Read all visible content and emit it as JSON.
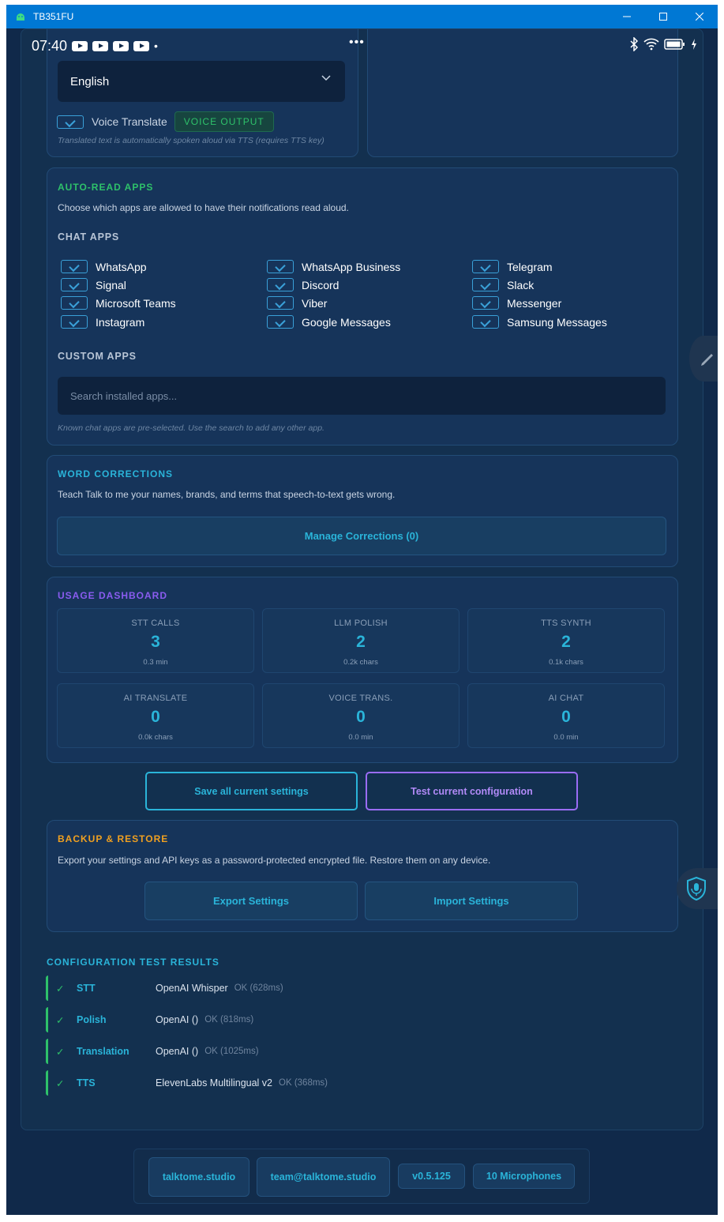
{
  "window": {
    "title": "TB351FU",
    "controls": [
      "minimize",
      "maximize",
      "close"
    ]
  },
  "statusbar": {
    "time": "07:40",
    "overflow": "•••",
    "dot": "•"
  },
  "translate": {
    "language": "English",
    "voice_translate_label": "Voice Translate",
    "voice_output_badge": "VOICE OUTPUT",
    "note": "Translated text is automatically spoken aloud via TTS (requires TTS key)"
  },
  "auto_read": {
    "title": "AUTO-READ APPS",
    "description": "Choose which apps are allowed to have their notifications read aloud.",
    "chat_apps_label": "CHAT APPS",
    "apps": [
      "WhatsApp",
      "WhatsApp Business",
      "Telegram",
      "Signal",
      "Discord",
      "Slack",
      "Microsoft Teams",
      "Viber",
      "Messenger",
      "Instagram",
      "Google Messages",
      "Samsung Messages"
    ],
    "custom_apps_label": "CUSTOM APPS",
    "search_placeholder": "Search installed apps...",
    "note": "Known chat apps are pre-selected. Use the search to add any other app."
  },
  "word_corrections": {
    "title": "WORD CORRECTIONS",
    "description": "Teach Talk to me your names, brands, and terms that speech-to-text gets wrong.",
    "button": "Manage Corrections (0)"
  },
  "usage": {
    "title": "USAGE DASHBOARD",
    "stats": [
      {
        "label": "STT CALLS",
        "value": "3",
        "unit": "0.3 min"
      },
      {
        "label": "LLM POLISH",
        "value": "2",
        "unit": "0.2k chars"
      },
      {
        "label": "TTS SYNTH",
        "value": "2",
        "unit": "0.1k chars"
      },
      {
        "label": "AI TRANSLATE",
        "value": "0",
        "unit": "0.0k chars"
      },
      {
        "label": "VOICE TRANS.",
        "value": "0",
        "unit": "0.0 min"
      },
      {
        "label": "AI CHAT",
        "value": "0",
        "unit": "0.0 min"
      }
    ]
  },
  "actions": {
    "save": "Save all current settings",
    "test": "Test current configuration"
  },
  "backup": {
    "title": "BACKUP & RESTORE",
    "description": "Export your settings and API keys as a password-protected encrypted file. Restore them on any device.",
    "export": "Export Settings",
    "import": "Import Settings"
  },
  "results": {
    "title": "CONFIGURATION TEST RESULTS",
    "items": [
      {
        "check": "✓",
        "key": "STT",
        "provider": "OpenAI Whisper",
        "status": "OK (628ms)"
      },
      {
        "check": "✓",
        "key": "Polish",
        "provider": "OpenAI ()",
        "status": "OK (818ms)"
      },
      {
        "check": "✓",
        "key": "Translation",
        "provider": "OpenAI ()",
        "status": "OK (1025ms)"
      },
      {
        "check": "✓",
        "key": "TTS",
        "provider": "ElevenLabs Multilingual v2",
        "status": "OK (368ms)"
      }
    ]
  },
  "footer": {
    "site": "talktome.studio",
    "email": "team@talktome.studio",
    "version": "v0.5.125",
    "mics": "10 Microphones"
  },
  "colors": {
    "green": "#2ec16a",
    "cyan": "#2ab4d9",
    "purple": "#8a5cf0",
    "orange": "#f0a020",
    "titlebar": "#0078d4"
  }
}
